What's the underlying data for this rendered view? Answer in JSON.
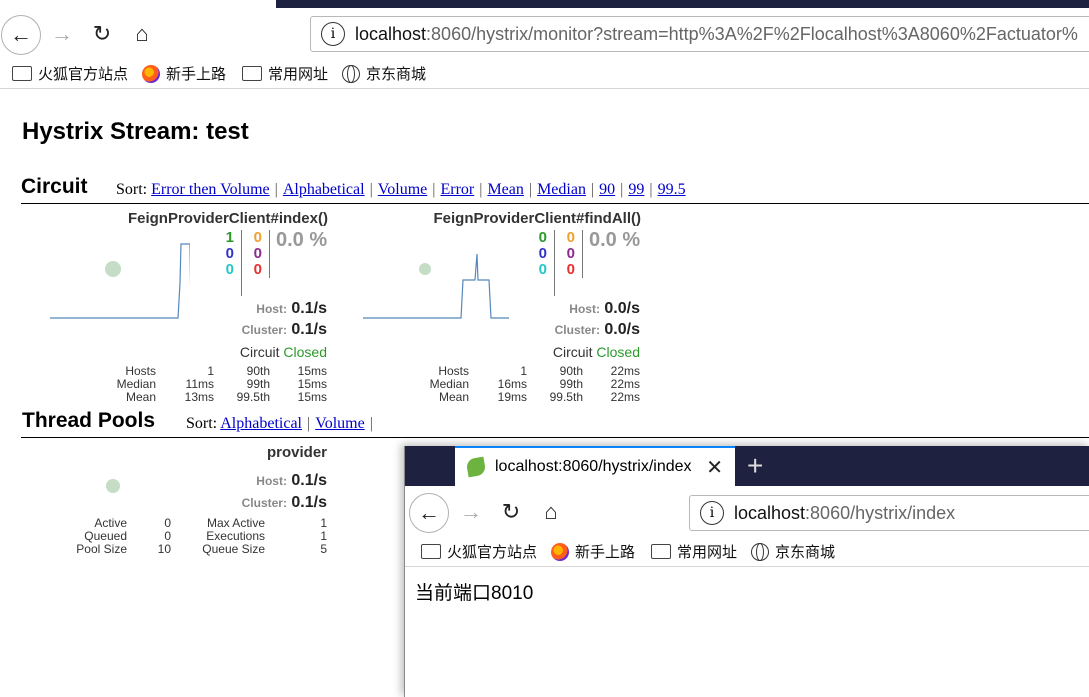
{
  "browser": {
    "url_host": "localhost",
    "url_rest": ":8060/hystrix/monitor?stream=http%3A%2F%2Flocalhost%3A8060%2Factuator%",
    "bookmarks": [
      "火狐官方站点",
      "新手上路",
      "常用网址",
      "京东商城"
    ]
  },
  "page": {
    "title": "Hystrix Stream: test",
    "circuit_heading": "Circuit",
    "sort_label": "Sort:",
    "circuit_sorts": [
      "Error then Volume",
      "Alphabetical",
      "Volume",
      "Error",
      "Mean",
      "Median",
      "90",
      "99",
      "99.5"
    ],
    "threadpool_heading": "Thread Pools",
    "threadpool_sorts": [
      "Alphabetical",
      "Volume"
    ]
  },
  "circuits": [
    {
      "name": "FeignProviderClient#index()",
      "counts": {
        "success": "1",
        "short": "0",
        "bad": "0",
        "timeout": "0",
        "rejected": "0",
        "failure": "0"
      },
      "error_pct": "0.0 %",
      "host_label": "Host:",
      "host_rate": "0.1/s",
      "cluster_label": "Cluster:",
      "cluster_rate": "0.1/s",
      "circuit_label": "Circuit",
      "circuit_state": "Closed",
      "stats": {
        "hosts_label": "Hosts",
        "hosts": "1",
        "median_label": "Median",
        "median": "11ms",
        "mean_label": "Mean",
        "mean": "13ms",
        "p90_label": "90th",
        "p90": "15ms",
        "p99_label": "99th",
        "p99": "15ms",
        "p995_label": "99.5th",
        "p995": "15ms"
      }
    },
    {
      "name": "FeignProviderClient#findAll()",
      "counts": {
        "success": "0",
        "short": "0",
        "bad": "0",
        "timeout": "0",
        "rejected": "0",
        "failure": "0"
      },
      "error_pct": "0.0 %",
      "host_label": "Host:",
      "host_rate": "0.0/s",
      "cluster_label": "Cluster:",
      "cluster_rate": "0.0/s",
      "circuit_label": "Circuit",
      "circuit_state": "Closed",
      "stats": {
        "hosts_label": "Hosts",
        "hosts": "1",
        "median_label": "Median",
        "median": "16ms",
        "mean_label": "Mean",
        "mean": "19ms",
        "p90_label": "90th",
        "p90": "22ms",
        "p99_label": "99th",
        "p99": "22ms",
        "p995_label": "99.5th",
        "p995": "22ms"
      }
    }
  ],
  "threadpool": {
    "name": "provider",
    "host_label": "Host:",
    "host_rate": "0.1/s",
    "cluster_label": "Cluster:",
    "cluster_rate": "0.1/s",
    "active_label": "Active",
    "active": "0",
    "queued_label": "Queued",
    "queued": "0",
    "poolsize_label": "Pool Size",
    "poolsize": "10",
    "maxactive_label": "Max Active",
    "maxactive": "1",
    "executions_label": "Executions",
    "executions": "1",
    "queuesize_label": "Queue Size",
    "queuesize": "5"
  },
  "window2": {
    "tab_title": "localhost:8060/hystrix/index",
    "url_host": "localhost",
    "url_rest": ":8060/hystrix/index",
    "bookmarks": [
      "火狐官方站点",
      "新手上路",
      "常用网址",
      "京东商城"
    ],
    "content": "当前端口8010"
  },
  "colors": {
    "success": "#2b9a2b",
    "short": "#3333cc",
    "bad": "#26c6c6",
    "timeout": "#f0a030",
    "rejected": "#8e2a8e",
    "failure": "#e83030",
    "tab_accent": "#0a84ff"
  }
}
